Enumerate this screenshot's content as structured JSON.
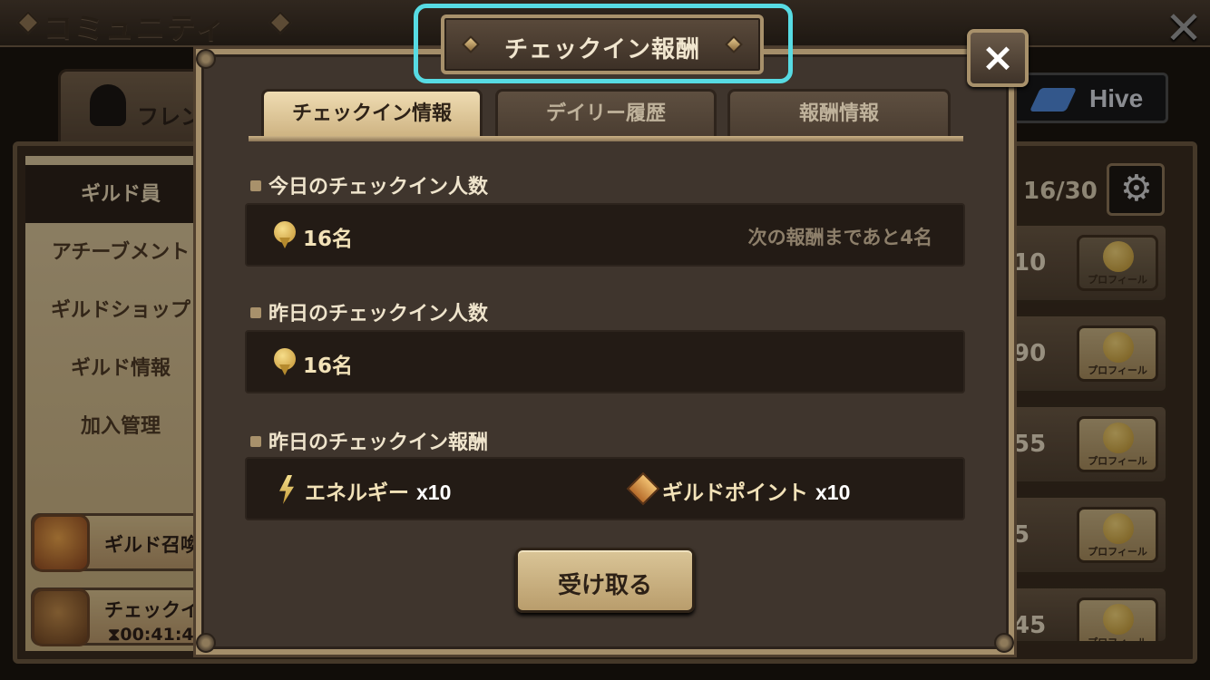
{
  "background": {
    "screen_title": "コミュニティ",
    "friend_tab_label": "フレン",
    "hive_label": "Hive",
    "sidebar": {
      "items": [
        {
          "label": "ギルド員"
        },
        {
          "label": "アチーブメント"
        },
        {
          "label": "ギルドショップ"
        },
        {
          "label": "ギルド情報"
        },
        {
          "label": "加入管理"
        }
      ],
      "summon_button": "ギルド召喚",
      "checkin_button": "チェックイ",
      "checkin_timer": "00:41:4"
    },
    "member_count": "16/30",
    "member_rows": [
      {
        "value": "10",
        "profile_label": "プロフィール"
      },
      {
        "value": "90",
        "profile_label": "プロフィール"
      },
      {
        "value": "55",
        "profile_label": "プロフィール"
      },
      {
        "value": "5",
        "profile_label": "プロフィール"
      },
      {
        "value": "45",
        "profile_label": "プロフィール"
      }
    ]
  },
  "modal": {
    "title": "チェックイン報酬",
    "close_label": "×",
    "tabs": [
      {
        "label": "チェックイン情報",
        "active": true
      },
      {
        "label": "デイリー履歴",
        "active": false
      },
      {
        "label": "報酬情報",
        "active": false
      }
    ],
    "today": {
      "label": "今日のチェックイン人数",
      "count": "16名",
      "next_reward": "次の報酬まであと4名"
    },
    "yesterday": {
      "label": "昨日のチェックイン人数",
      "count": "16名"
    },
    "yesterday_rewards": {
      "label": "昨日のチェックイン報酬",
      "items": [
        {
          "name": "エネルギー",
          "amount": "x10",
          "icon": "energy-icon"
        },
        {
          "name": "ギルドポイント",
          "amount": "x10",
          "icon": "guild-point-icon"
        }
      ]
    },
    "receive_button": "受け取る"
  },
  "colors": {
    "highlight": "#57dbe3",
    "accent_gold": "#a8916b"
  }
}
